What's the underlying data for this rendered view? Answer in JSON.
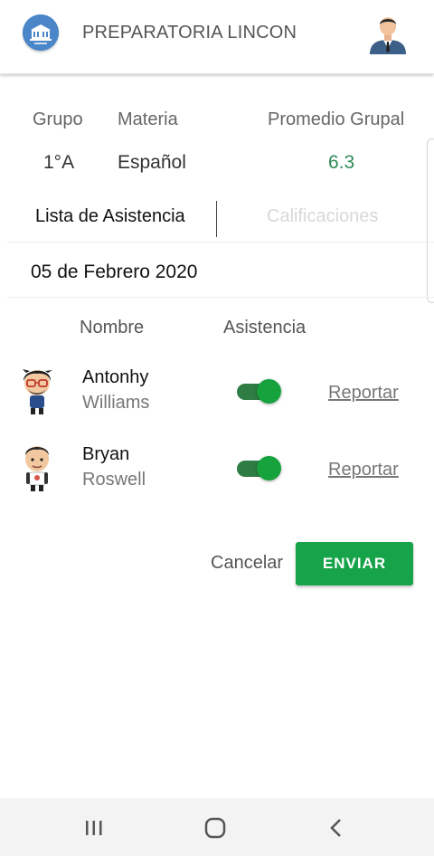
{
  "app": {
    "title": "PREPARATORIA LINCON"
  },
  "info": {
    "grupo_label": "Grupo",
    "grupo_value": "1°A",
    "materia_label": "Materia",
    "materia_value": "Español",
    "promedio_label": "Promedio Grupal",
    "promedio_value": "6.3"
  },
  "tabs": [
    {
      "label": "Lista de Asistencia",
      "active": true
    },
    {
      "label": "Calificaciones",
      "active": false
    }
  ],
  "date": "05 de Febrero 2020",
  "columns": {
    "nombre": "Nombre",
    "asistencia": "Asistencia"
  },
  "students": [
    {
      "first": "Antonhy",
      "last": "Williams",
      "present": true,
      "report_label": "Reportar"
    },
    {
      "first": "Bryan",
      "last": "Roswell",
      "present": true,
      "report_label": "Reportar"
    }
  ],
  "actions": {
    "cancel_label": "Cancelar",
    "send_label": "ENVIAR"
  },
  "colors": {
    "accent": "#16a34a",
    "promedio": "#2e8b57",
    "logo_blue": "#4a86c8"
  },
  "icons": {
    "nav_recent": "recent-apps-icon",
    "nav_home": "home-icon",
    "nav_back": "back-icon"
  }
}
